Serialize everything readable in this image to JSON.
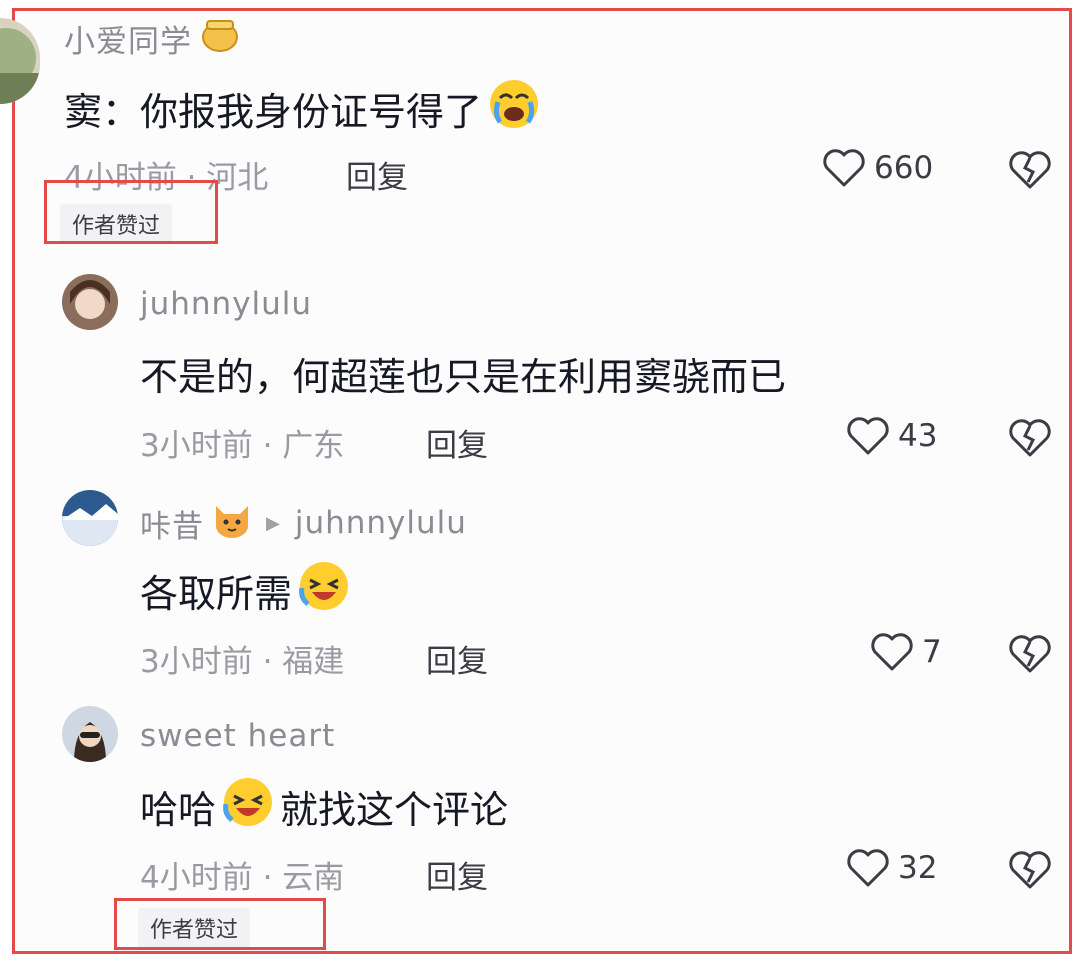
{
  "comments": [
    {
      "username": "小爱同学",
      "text": "窦：你报我身份证号得了",
      "time_location": "4小时前 · 河北",
      "reply_label": "回复",
      "likes": "660",
      "badge": "作者赞过"
    },
    {
      "username": "juhnnylulu",
      "text": "不是的，何超莲也只是在利用窦骁而已",
      "time_location": "3小时前 · 广东",
      "reply_label": "回复",
      "likes": "43"
    },
    {
      "username": "咔昔",
      "reply_to": "juhnnylulu",
      "text": "各取所需",
      "time_location": "3小时前 · 福建",
      "reply_label": "回复",
      "likes": "7"
    },
    {
      "username": "sweet heart",
      "text_before": "哈哈",
      "text_after": "就找这个评论",
      "time_location": "4小时前 · 云南",
      "reply_label": "回复",
      "likes": "32",
      "badge": "作者赞过"
    }
  ],
  "colors": {
    "highlight": "#e34a4a",
    "meta_text": "#9a9aa2",
    "body_text": "#161823"
  }
}
